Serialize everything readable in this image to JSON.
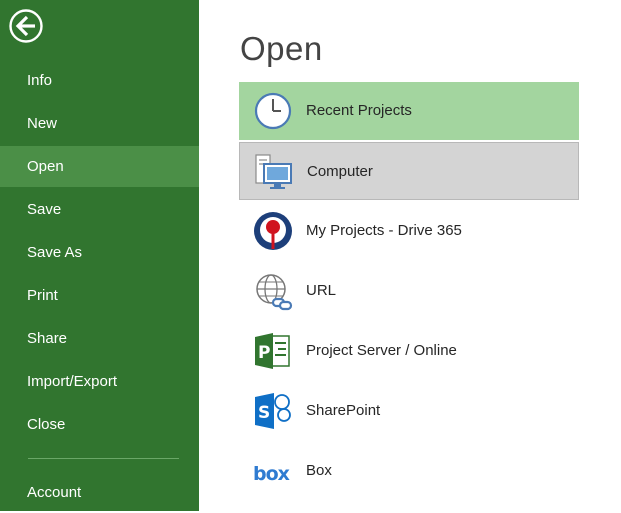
{
  "sidebar": {
    "back_icon": "back-arrow-icon",
    "items": [
      {
        "label": "Info"
      },
      {
        "label": "New"
      },
      {
        "label": "Open"
      },
      {
        "label": "Save"
      },
      {
        "label": "Save As"
      },
      {
        "label": "Print"
      },
      {
        "label": "Share"
      },
      {
        "label": "Import/Export"
      },
      {
        "label": "Close"
      }
    ],
    "account_label": "Account",
    "active": "Open"
  },
  "main": {
    "title": "Open",
    "locations": [
      {
        "label": "Recent Projects",
        "icon": "clock-icon",
        "state": "selected"
      },
      {
        "label": "Computer",
        "icon": "computer-icon",
        "state": "hover"
      },
      {
        "label": "My Projects - Drive 365",
        "icon": "drive-365-icon",
        "state": "normal"
      },
      {
        "label": "URL",
        "icon": "url-globe-icon",
        "state": "normal"
      },
      {
        "label": "Project Server / Online",
        "icon": "project-server-icon",
        "state": "normal"
      },
      {
        "label": "SharePoint",
        "icon": "sharepoint-icon",
        "state": "normal"
      },
      {
        "label": "Box",
        "icon": "box-icon",
        "state": "normal"
      }
    ]
  },
  "colors": {
    "sidebar_bg": "#31752f",
    "sidebar_active": "#4b8f47",
    "selected_bg": "#a3d59f",
    "hover_bg": "#d4d4d4"
  }
}
